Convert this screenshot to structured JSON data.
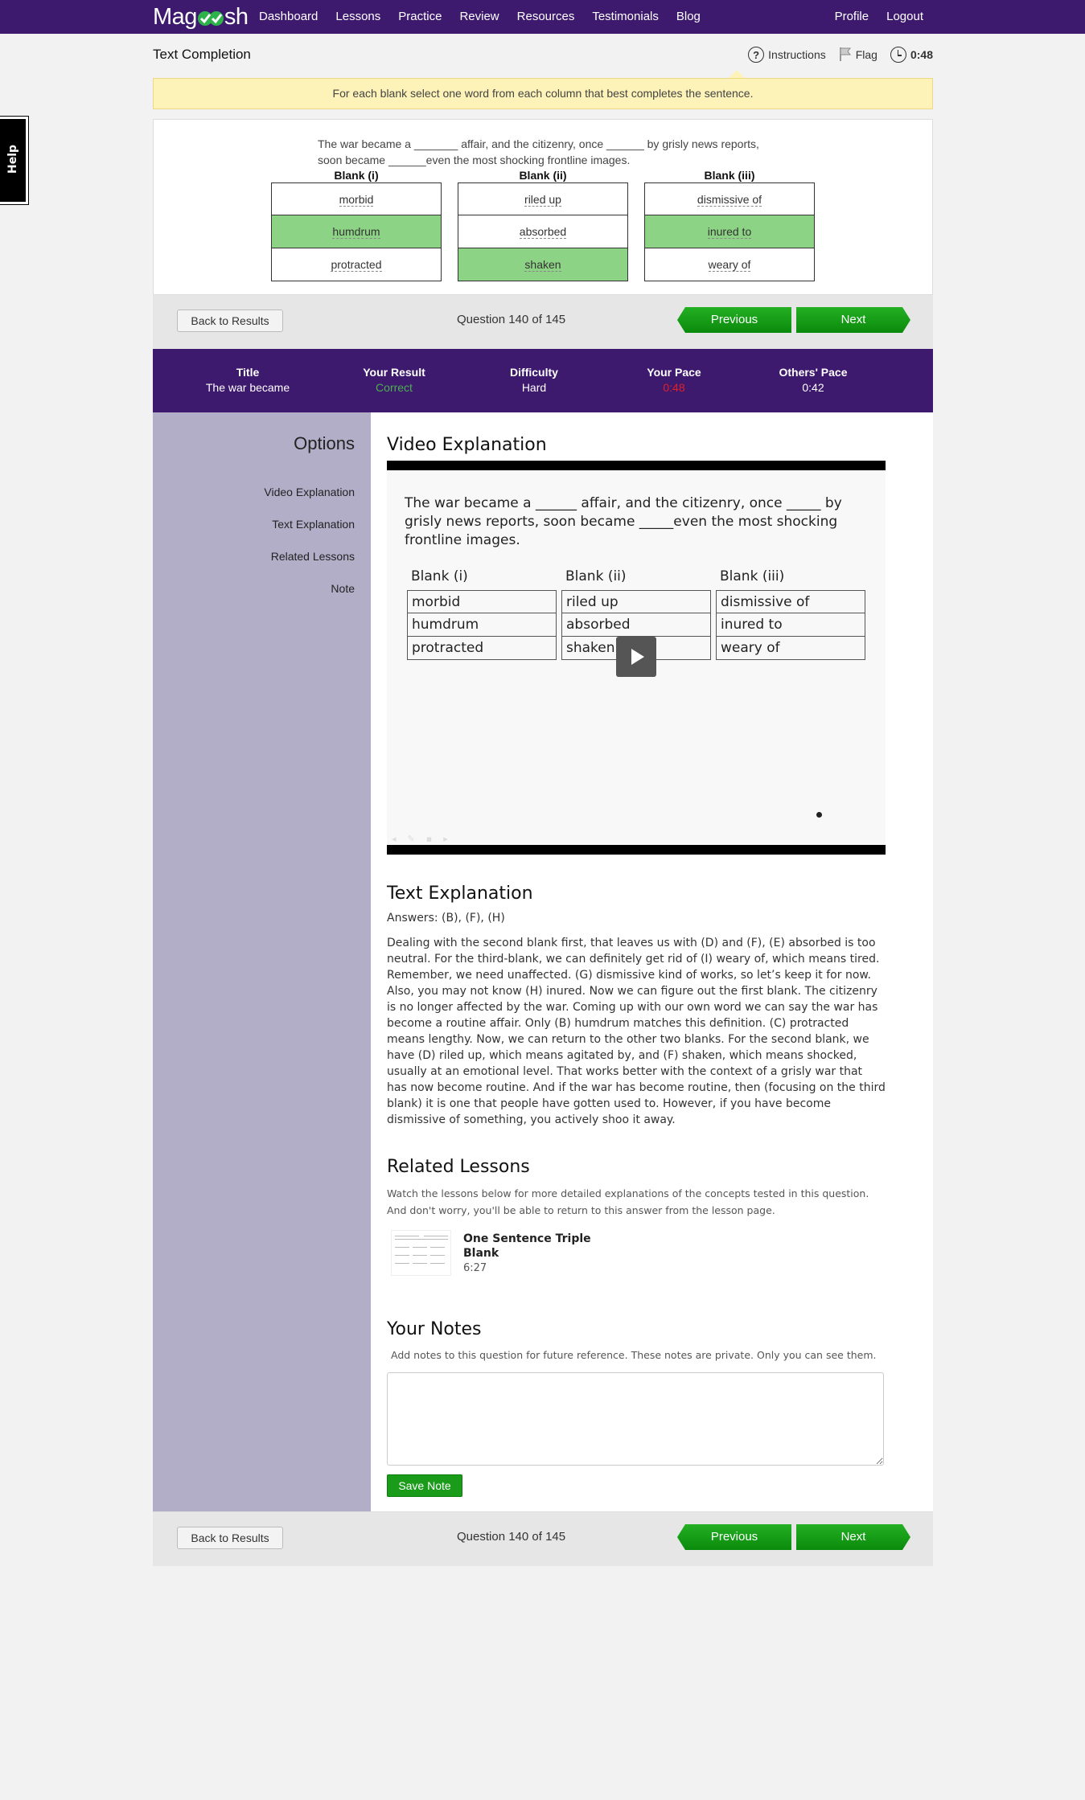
{
  "nav": {
    "logo": "Magoosh",
    "items": [
      "Dashboard",
      "Lessons",
      "Practice",
      "Review",
      "Resources",
      "Testimonials",
      "Blog"
    ],
    "right": [
      "Profile",
      "Logout"
    ]
  },
  "header": {
    "question_type": "Text Completion",
    "instructions_label": "Instructions",
    "flag_label": "Flag",
    "timer": "0:48"
  },
  "instructions_text": "For each blank select one word from each column that best completes the sentence.",
  "help_label": "Help",
  "question": {
    "text": "The war became a _______ affair, and the citizenry, once ______ by grisly news reports, soon became ______even the most shocking frontline images.",
    "columns": [
      {
        "header": "Blank (i)",
        "options": [
          "morbid",
          "humdrum",
          "protracted"
        ],
        "selected_index": 1
      },
      {
        "header": "Blank (ii)",
        "options": [
          "riled up",
          "absorbed",
          "shaken"
        ],
        "selected_index": 2
      },
      {
        "header": "Blank (iii)",
        "options": [
          "dismissive of",
          "inured to",
          "weary of"
        ],
        "selected_index": 1
      }
    ]
  },
  "navbar": {
    "back_label": "Back to Results",
    "counter": "Question 140 of 145",
    "previous_label": "Previous",
    "next_label": "Next"
  },
  "stats": {
    "title_label": "Title",
    "title_value": "The war became",
    "result_label": "Your Result",
    "result_value": "Correct",
    "difficulty_label": "Difficulty",
    "difficulty_value": "Hard",
    "pace_label": "Your Pace",
    "pace_value": "0:48",
    "others_label": "Others' Pace",
    "others_value": "0:42",
    "colors": {
      "correct": "#4caf50",
      "pace": "#e0202a"
    }
  },
  "options": {
    "title": "Options",
    "items": [
      "Video Explanation",
      "Text Explanation",
      "Related Lessons",
      "Note"
    ]
  },
  "video": {
    "title": "Video Explanation",
    "question": "The war became a ______ affair, and the citizenry, once _____ by grisly news reports, soon became _____even the most shocking frontline images.",
    "headers": [
      "Blank (i)",
      "Blank (ii)",
      "Blank (iii)"
    ],
    "col1": [
      "morbid",
      "humdrum",
      "protracted"
    ],
    "col2": [
      "riled up",
      "absorbed",
      "shaken"
    ],
    "col3": [
      "dismissive of",
      "inured to",
      "weary of"
    ]
  },
  "text_explanation": {
    "title": "Text Explanation",
    "answers": "Answers: (B), (F), (H)",
    "body": "Dealing with the second blank first, that leaves us with (D) and (F), (E) absorbed is too neutral. For the third-blank, we can definitely get rid of (I) weary of, which means tired. Remember, we need unaffected. (G) dismissive kind of works, so let’s keep it for now. Also, you may not know (H) inured. Now we can figure out the first blank. The citizenry is no longer affected by the war. Coming up with our own word we can say the war has become a routine affair. Only (B) humdrum matches this definition. (C) protracted means lengthy. Now, we can return to the other two blanks. For the second blank, we have (D) riled up, which means agitated by, and (F) shaken, which means shocked, usually at an emotional level. That works better with the context of a grisly war that has now become routine. And if the war has become routine, then (focusing on the third blank) it is one that people have gotten used to. However, if you have become dismissive of something, you actively shoo it away."
  },
  "related": {
    "title": "Related Lessons",
    "desc": "Watch the lessons below for more detailed explanations of the concepts tested in this question. And don't worry, you'll be able to return to this answer from the lesson page.",
    "lesson_title": "One Sentence Triple Blank",
    "lesson_time": "6:27"
  },
  "notes": {
    "title": "Your Notes",
    "desc": "Add notes to this question for future reference. These notes are private. Only you can see them.",
    "value": "",
    "save_label": "Save Note"
  },
  "colors": {
    "purple": "#3d1a6e",
    "green": "#1a9b1a",
    "selected": "#8dd385",
    "banner": "#fdf2b7",
    "sidebar": "#b3aec8"
  }
}
